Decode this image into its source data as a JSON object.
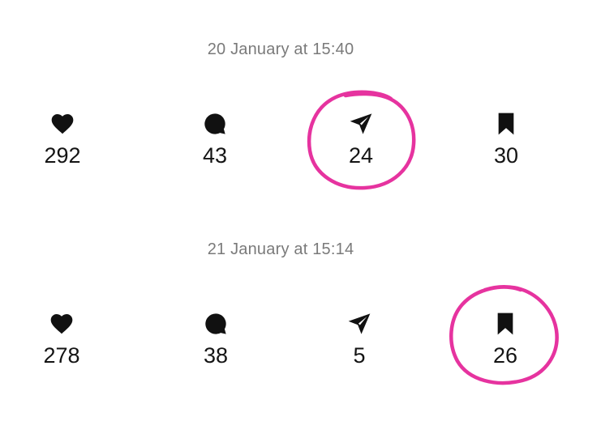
{
  "posts": [
    {
      "timestamp": "20 January at 15:40",
      "stats": {
        "likes": "292",
        "comments": "43",
        "shares": "24",
        "saves": "30"
      },
      "highlighted": "shares"
    },
    {
      "timestamp": "21 January at 15:14",
      "stats": {
        "likes": "278",
        "comments": "38",
        "shares": "5",
        "saves": "26"
      },
      "highlighted": "saves"
    }
  ],
  "icons": {
    "likes": "heart-icon",
    "comments": "comment-bubble-icon",
    "shares": "paper-plane-icon",
    "saves": "bookmark-icon"
  },
  "colors": {
    "highlight": "#e6339f",
    "icon": "#111111",
    "timestamp": "#7a7a7a"
  }
}
